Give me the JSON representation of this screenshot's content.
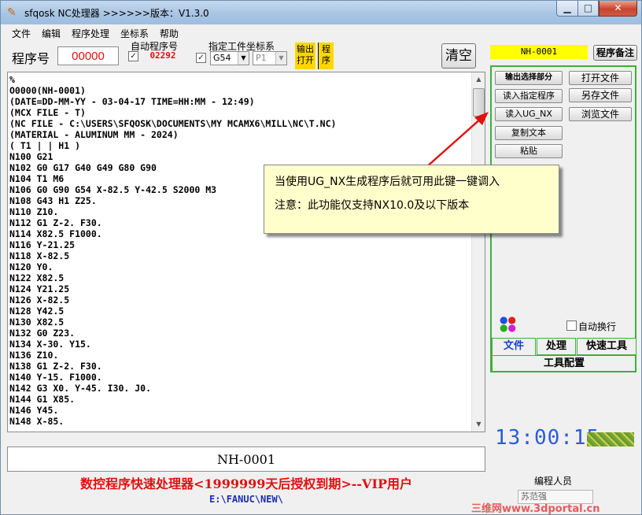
{
  "window": {
    "title": "sfqosk NC处理器 >>>>>>版本：V1.3.0",
    "icon": "app-pen-icon"
  },
  "menu": [
    "文件",
    "编辑",
    "程序处理",
    "坐标系",
    "帮助"
  ],
  "toolbar": {
    "program_no_label": "程序号",
    "program_no_value": "00000",
    "auto_program_label": "自动程序号",
    "auto_program_value": "02292",
    "auto_program_checked": true,
    "work_coord_label": "指定工件坐标系",
    "work_coord_checked": true,
    "work_coord_value": "G54",
    "p_value": "P1",
    "output_open_label": "输出\n打开",
    "program_label": "程\n序",
    "clear_label": "清空"
  },
  "editor": {
    "lines": [
      "%",
      "O0000(NH-0001)",
      "(DATE=DD-MM-YY - 03-04-17 TIME=HH:MM - 12:49)",
      "(MCX FILE - T)",
      "(NC FILE - C:\\USERS\\SFQOSK\\DOCUMENTS\\MY MCAMX6\\MILL\\NC\\T.NC)",
      "(MATERIAL - ALUMINUM MM - 2024)",
      "( T1 | | H1 )",
      "N100 G21",
      "N102 G0 G17 G40 G49 G80 G90",
      "N104 T1 M6",
      "N106 G0 G90 G54 X-82.5 Y-42.5 S2000 M3",
      "N108 G43 H1 Z25.",
      "N110 Z10.",
      "N112 G1 Z-2. F30.",
      "N114 X82.5 F1000.",
      "N116 Y-21.25",
      "N118 X-82.5",
      "N120 Y0.",
      "N122 X82.5",
      "N124 Y21.25",
      "N126 X-82.5",
      "N128 Y42.5",
      "N130 X82.5",
      "N132 G0 Z23.",
      "N134 X-30. Y15.",
      "N136 Z10.",
      "N138 G1 Z-2. F30.",
      "N140 Y-15. F1000.",
      "N142 G3 X0. Y-45. I30. J0.",
      "N144 G1 X85.",
      "N146 Y45.",
      "N148 X-85."
    ]
  },
  "program_name": "NH-0001",
  "footer": {
    "license": "数控程序快速处理器<1999999天后授权到期>--VIP用户",
    "path": "E:\\FANUC\\NEW\\"
  },
  "right": {
    "program_id": "NH-0001",
    "remarks_label": "程序备注",
    "buttons_left": [
      "输出选择部分",
      "读入指定程序",
      "读入UG_NX",
      "复制文本",
      "粘贴"
    ],
    "buttons_right": [
      "打开文件",
      "另存文件",
      "浏览文件"
    ],
    "auto_wrap_label": "自动换行",
    "auto_wrap_checked": false,
    "tabs": [
      "文件",
      "处理",
      "快速工具"
    ],
    "tool_config_label": "工具配置",
    "clock": "13:00:15",
    "programmer_label": "编程人员",
    "programmer_value": "苏范强"
  },
  "callout": {
    "line1": "当使用UG_NX生成程序后就可用此键一键调入",
    "line2": "注意：此功能仅支持NX10.0及以下版本"
  },
  "watermark": "三维网www.3dportal.cn",
  "colors": {
    "accent_green": "#3cb03c",
    "id_yellow": "#ffff00",
    "footer_red": "#e01010",
    "clock_blue": "#2a5cd8",
    "callout_bg": "#ffffcc"
  }
}
